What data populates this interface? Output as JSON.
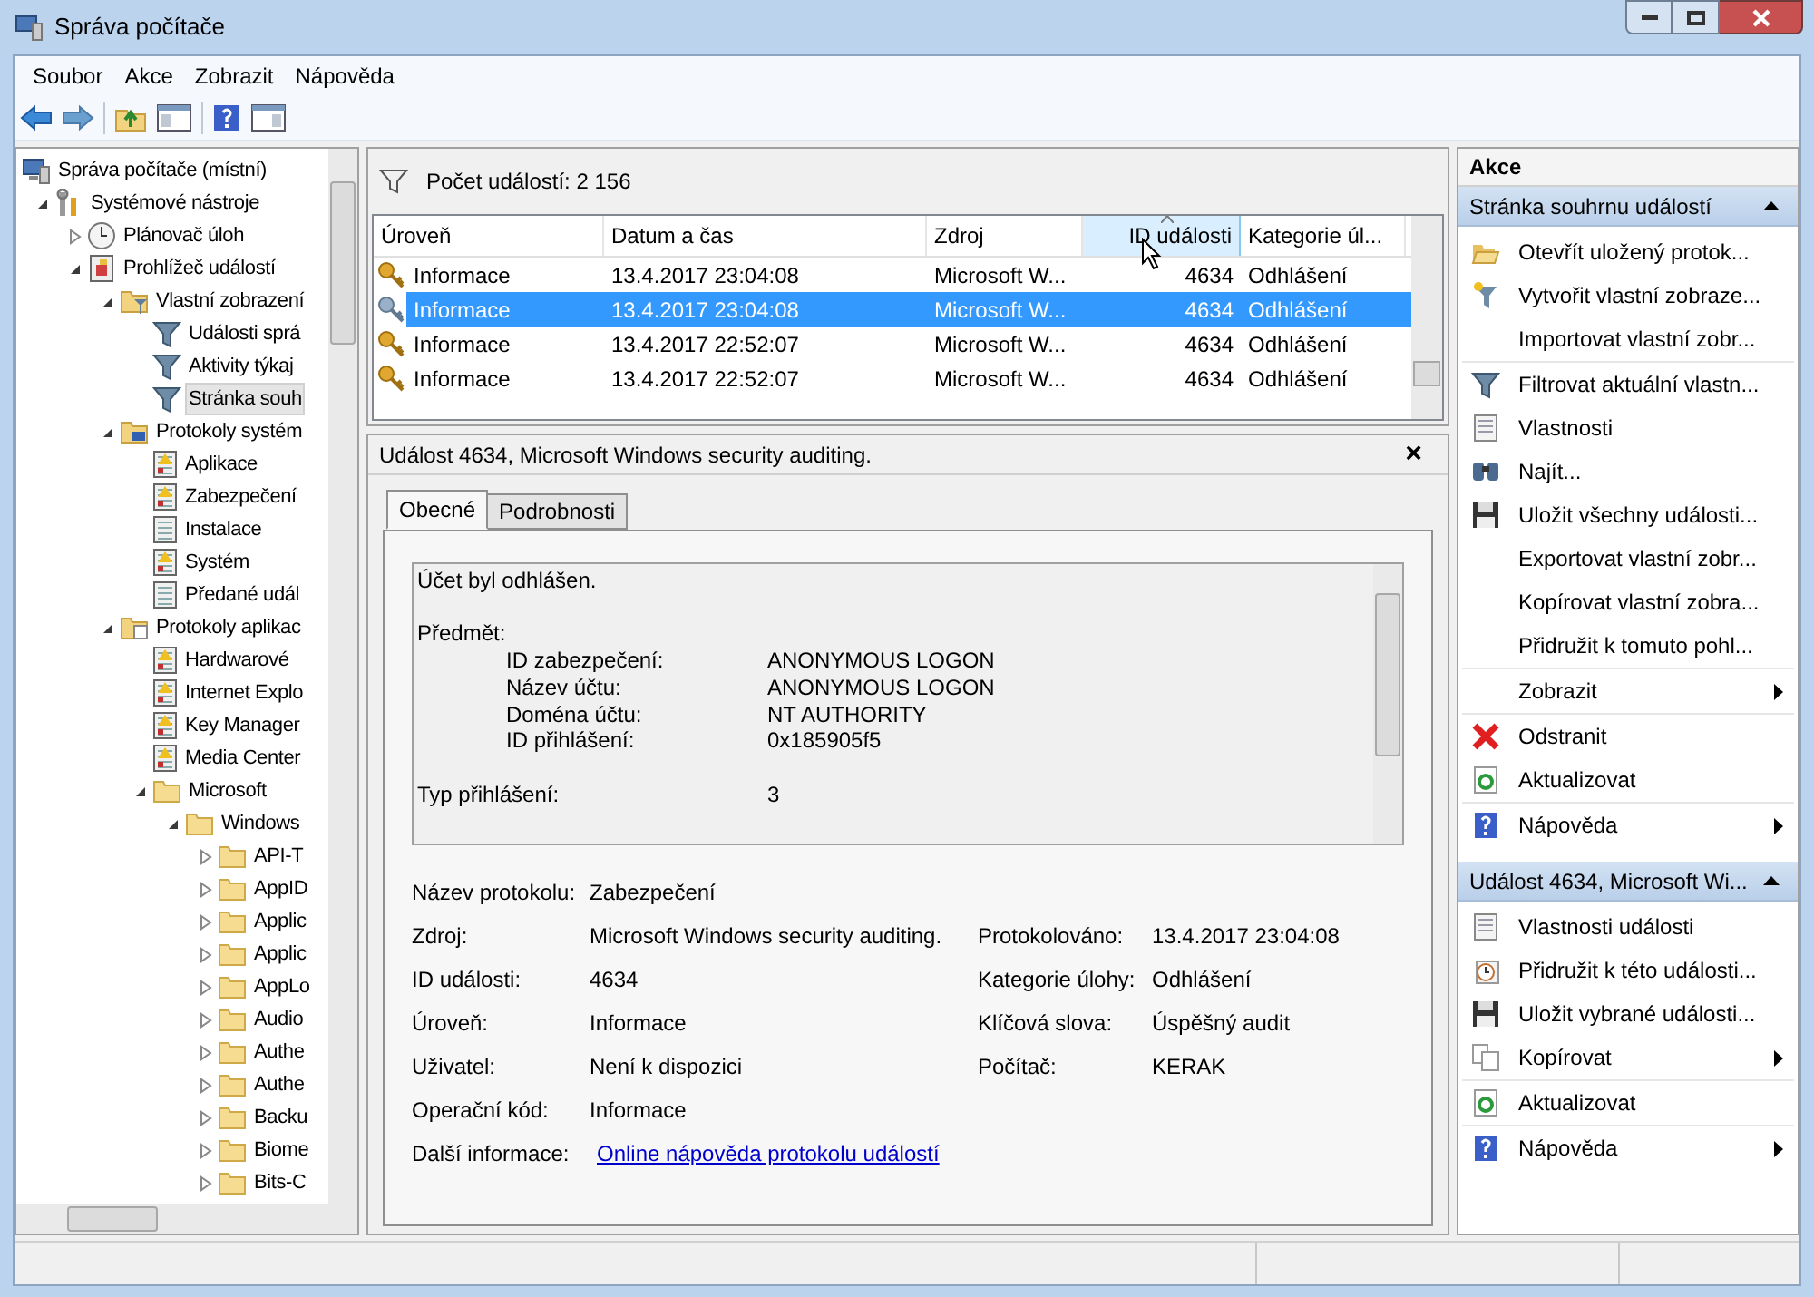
{
  "window": {
    "title": "Správa počítače"
  },
  "menu": [
    "Soubor",
    "Akce",
    "Zobrazit",
    "Nápověda"
  ],
  "tree": [
    {
      "label": "Správa počítače (místní)",
      "kind": "computer",
      "selected": false,
      "children": [
        {
          "label": "Systémové nástroje",
          "kind": "tools",
          "selected": false,
          "expanded": true,
          "children": [
            {
              "label": "Plánovač úloh",
              "kind": "clock",
              "selected": false,
              "expanded": false
            },
            {
              "label": "Prohlížeč událostí",
              "kind": "viewer",
              "selected": false,
              "expanded": true,
              "children": [
                {
                  "label": "Vlastní zobrazení",
                  "kind": "folder-filter",
                  "selected": false,
                  "expanded": true,
                  "children": [
                    {
                      "label": "Události sprá",
                      "kind": "filter",
                      "selected": false
                    },
                    {
                      "label": "Aktivity týkaj",
                      "kind": "filter",
                      "selected": false
                    },
                    {
                      "label": "Stránka souh",
                      "kind": "filter",
                      "selected": true
                    }
                  ]
                },
                {
                  "label": "Protokoly systém",
                  "kind": "folder-log",
                  "selected": false,
                  "expanded": true,
                  "children": [
                    {
                      "label": "Aplikace",
                      "kind": "log",
                      "selected": false
                    },
                    {
                      "label": "Zabezpečení",
                      "kind": "log",
                      "selected": false
                    },
                    {
                      "label": "Instalace",
                      "kind": "log-plain",
                      "selected": false
                    },
                    {
                      "label": "Systém",
                      "kind": "log",
                      "selected": false
                    },
                    {
                      "label": "Předané udál",
                      "kind": "log-plain",
                      "selected": false
                    }
                  ]
                },
                {
                  "label": "Protokoly aplikac",
                  "kind": "folder-doc",
                  "selected": false,
                  "expanded": true,
                  "children": [
                    {
                      "label": "Hardwarové",
                      "kind": "log",
                      "selected": false
                    },
                    {
                      "label": "Internet Explo",
                      "kind": "log",
                      "selected": false
                    },
                    {
                      "label": "Key Manager",
                      "kind": "log",
                      "selected": false
                    },
                    {
                      "label": "Media Center",
                      "kind": "log",
                      "selected": false
                    },
                    {
                      "label": "Microsoft",
                      "kind": "folder",
                      "selected": false,
                      "expanded": true,
                      "children": [
                        {
                          "label": "Windows",
                          "kind": "folder",
                          "selected": false,
                          "expanded": true,
                          "children": [
                            {
                              "label": "API-T",
                              "kind": "folder",
                              "selected": false,
                              "expanded": false
                            },
                            {
                              "label": "AppID",
                              "kind": "folder",
                              "selected": false,
                              "expanded": false
                            },
                            {
                              "label": "Applic",
                              "kind": "folder",
                              "selected": false,
                              "expanded": false
                            },
                            {
                              "label": "Applic",
                              "kind": "folder",
                              "selected": false,
                              "expanded": false
                            },
                            {
                              "label": "AppLo",
                              "kind": "folder",
                              "selected": false,
                              "expanded": false
                            },
                            {
                              "label": "Audio",
                              "kind": "folder",
                              "selected": false,
                              "expanded": false
                            },
                            {
                              "label": "Authe",
                              "kind": "folder",
                              "selected": false,
                              "expanded": false
                            },
                            {
                              "label": "Authe",
                              "kind": "folder",
                              "selected": false,
                              "expanded": false
                            },
                            {
                              "label": "Backu",
                              "kind": "folder",
                              "selected": false,
                              "expanded": false
                            },
                            {
                              "label": "Biome",
                              "kind": "folder",
                              "selected": false,
                              "expanded": false
                            },
                            {
                              "label": "Bits-C",
                              "kind": "folder",
                              "selected": false,
                              "expanded": false
                            }
                          ]
                        }
                      ]
                    }
                  ]
                }
              ]
            }
          ]
        }
      ]
    }
  ],
  "events": {
    "count_label": "Počet událostí: 2 156",
    "columns": [
      {
        "label": "Úroveň",
        "hovered": false,
        "sorted": false
      },
      {
        "label": "Datum a čas",
        "hovered": false,
        "sorted": false
      },
      {
        "label": "Zdroj",
        "hovered": false,
        "sorted": false
      },
      {
        "label": "ID události",
        "hovered": true,
        "sorted": true
      },
      {
        "label": "Kategorie úl...",
        "hovered": false,
        "sorted": false
      }
    ],
    "rows": [
      {
        "selected": false,
        "cells": [
          "Informace",
          "13.4.2017 23:04:08",
          "Microsoft W...",
          "4634",
          "Odhlášení"
        ]
      },
      {
        "selected": true,
        "cells": [
          "Informace",
          "13.4.2017 23:04:08",
          "Microsoft W...",
          "4634",
          "Odhlášení"
        ]
      },
      {
        "selected": false,
        "cells": [
          "Informace",
          "13.4.2017 22:52:07",
          "Microsoft W...",
          "4634",
          "Odhlášení"
        ]
      },
      {
        "selected": false,
        "cells": [
          "Informace",
          "13.4.2017 22:52:07",
          "Microsoft W...",
          "4634",
          "Odhlášení"
        ]
      }
    ]
  },
  "detail": {
    "title": "Událost 4634, Microsoft Windows security auditing.",
    "close": "×",
    "tabs": [
      {
        "label": "Obecné",
        "selected": true
      },
      {
        "label": "Podrobnosti",
        "selected": false
      }
    ],
    "message": {
      "summary": "Účet byl odhlášen.",
      "subject_label": "Předmět:",
      "subject_fields": [
        {
          "label": "ID zabezpečení:",
          "value": "ANONYMOUS LOGON"
        },
        {
          "label": "Název účtu:",
          "value": "ANONYMOUS LOGON"
        },
        {
          "label": "Doména účtu:",
          "value": "NT AUTHORITY"
        },
        {
          "label": "ID přihlášení:",
          "value": "0x185905f5"
        }
      ],
      "logon_type": {
        "label": "Typ přihlášení:",
        "value": "3"
      }
    },
    "properties": [
      [
        {
          "label": "Název protokolu:",
          "value": "Zabezpečení"
        }
      ],
      [
        {
          "label": "Zdroj:",
          "value": "Microsoft Windows security auditing."
        },
        {
          "label": "Protokolováno:",
          "value": "13.4.2017 23:04:08"
        }
      ],
      [
        {
          "label": "ID události:",
          "value": "4634"
        },
        {
          "label": "Kategorie úlohy:",
          "value": "Odhlášení"
        }
      ],
      [
        {
          "label": "Úroveň:",
          "value": "Informace"
        },
        {
          "label": "Klíčová slova:",
          "value": "Úspěšný audit"
        }
      ],
      [
        {
          "label": "Uživatel:",
          "value": "Není k dispozici"
        },
        {
          "label": "Počítač:",
          "value": "KERAK"
        }
      ],
      [
        {
          "label": "Operační kód:",
          "value": "Informace"
        }
      ]
    ],
    "more_info": {
      "label": "Další informace:",
      "link": "Online nápověda protokolu událostí"
    }
  },
  "actions": {
    "title": "Akce",
    "sections": [
      {
        "title": "Stránka souhrnu událostí",
        "expanded": true,
        "groups": [
          [
            {
              "label": "Otevřít uložený protok...",
              "kind": "open-folder",
              "submenu": false
            },
            {
              "label": "Vytvořit vlastní zobraze...",
              "kind": "funnel-star",
              "submenu": false
            },
            {
              "label": "Importovat vlastní zobr...",
              "kind": "plain",
              "submenu": false
            }
          ],
          [
            {
              "label": "Filtrovat aktuální vlastn...",
              "kind": "funnel",
              "submenu": false
            },
            {
              "label": "Vlastnosti",
              "kind": "properties",
              "submenu": false
            },
            {
              "label": "Najít...",
              "kind": "binoculars",
              "submenu": false
            },
            {
              "label": "Uložit všechny události...",
              "kind": "floppy",
              "submenu": false
            },
            {
              "label": "Exportovat vlastní zobr...",
              "kind": "plain",
              "submenu": false
            },
            {
              "label": "Kopírovat vlastní zobra...",
              "kind": "plain",
              "submenu": false
            },
            {
              "label": "Přidružit k tomuto pohl...",
              "kind": "plain",
              "submenu": false
            }
          ],
          [
            {
              "label": "Zobrazit",
              "kind": "plain",
              "submenu": true
            }
          ],
          [
            {
              "label": "Odstranit",
              "kind": "delete",
              "submenu": false
            },
            {
              "label": "Aktualizovat",
              "kind": "refresh",
              "submenu": false
            }
          ],
          [
            {
              "label": "Nápověda",
              "kind": "help",
              "submenu": true
            }
          ]
        ]
      },
      {
        "title": "Událost 4634, Microsoft Wi...",
        "expanded": true,
        "groups": [
          [
            {
              "label": "Vlastnosti události",
              "kind": "properties",
              "submenu": false
            },
            {
              "label": "Přidružit k této události...",
              "kind": "attach-clock",
              "submenu": false
            },
            {
              "label": "Uložit vybrané události...",
              "kind": "floppy",
              "submenu": false
            },
            {
              "label": "Kopírovat",
              "kind": "copy",
              "submenu": true
            }
          ],
          [
            {
              "label": "Aktualizovat",
              "kind": "refresh",
              "submenu": false
            }
          ],
          [
            {
              "label": "Nápověda",
              "kind": "help",
              "submenu": true
            }
          ]
        ]
      }
    ]
  }
}
